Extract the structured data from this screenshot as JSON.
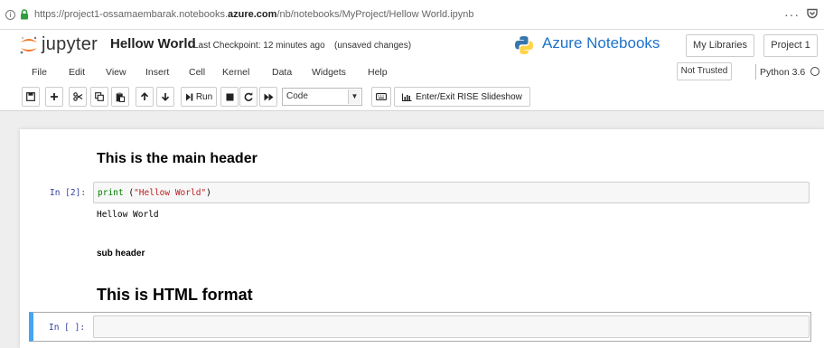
{
  "browser": {
    "url_prefix": "https://project1-ossamaembarak.notebooks.",
    "url_host": "azure.com",
    "url_path": "/nb/notebooks/MyProject/Hellow World.ipynb",
    "more_label": "···"
  },
  "header": {
    "app_name": "jupyter",
    "notebook_name": "Hellow World",
    "checkpoint": "Last Checkpoint: 12 minutes ago",
    "autosave": "(unsaved changes)",
    "brand_title": "Azure Notebooks",
    "my_libraries_label": "My Libraries",
    "project_label": "Project 1"
  },
  "menubar": {
    "items": [
      "File",
      "Edit",
      "View",
      "Insert",
      "Cell",
      "Kernel",
      "Data",
      "Widgets",
      "Help"
    ],
    "trusted_label": "Not Trusted",
    "kernel_label": "Python 3.6"
  },
  "toolbar": {
    "run_label": "Run",
    "cell_type": "Code",
    "slideshow_label": "Enter/Exit RISE Slideshow"
  },
  "notebook": {
    "main_header": "This is the main header",
    "in2_prompt": "In [2]:",
    "code_keyword": "print",
    "code_open": " (",
    "code_string": "\"Hellow World\"",
    "code_close": ")",
    "output": "Hellow World",
    "sub_header": "sub header",
    "html_header": "This is HTML format",
    "empty_prompt": "In [ ]:"
  },
  "colors": {
    "jupyter_orange": "#f37626",
    "azure_blue": "#1f73c9",
    "prompt_blue": "#303f9f",
    "selected_cell_blue": "#42a5f5"
  }
}
